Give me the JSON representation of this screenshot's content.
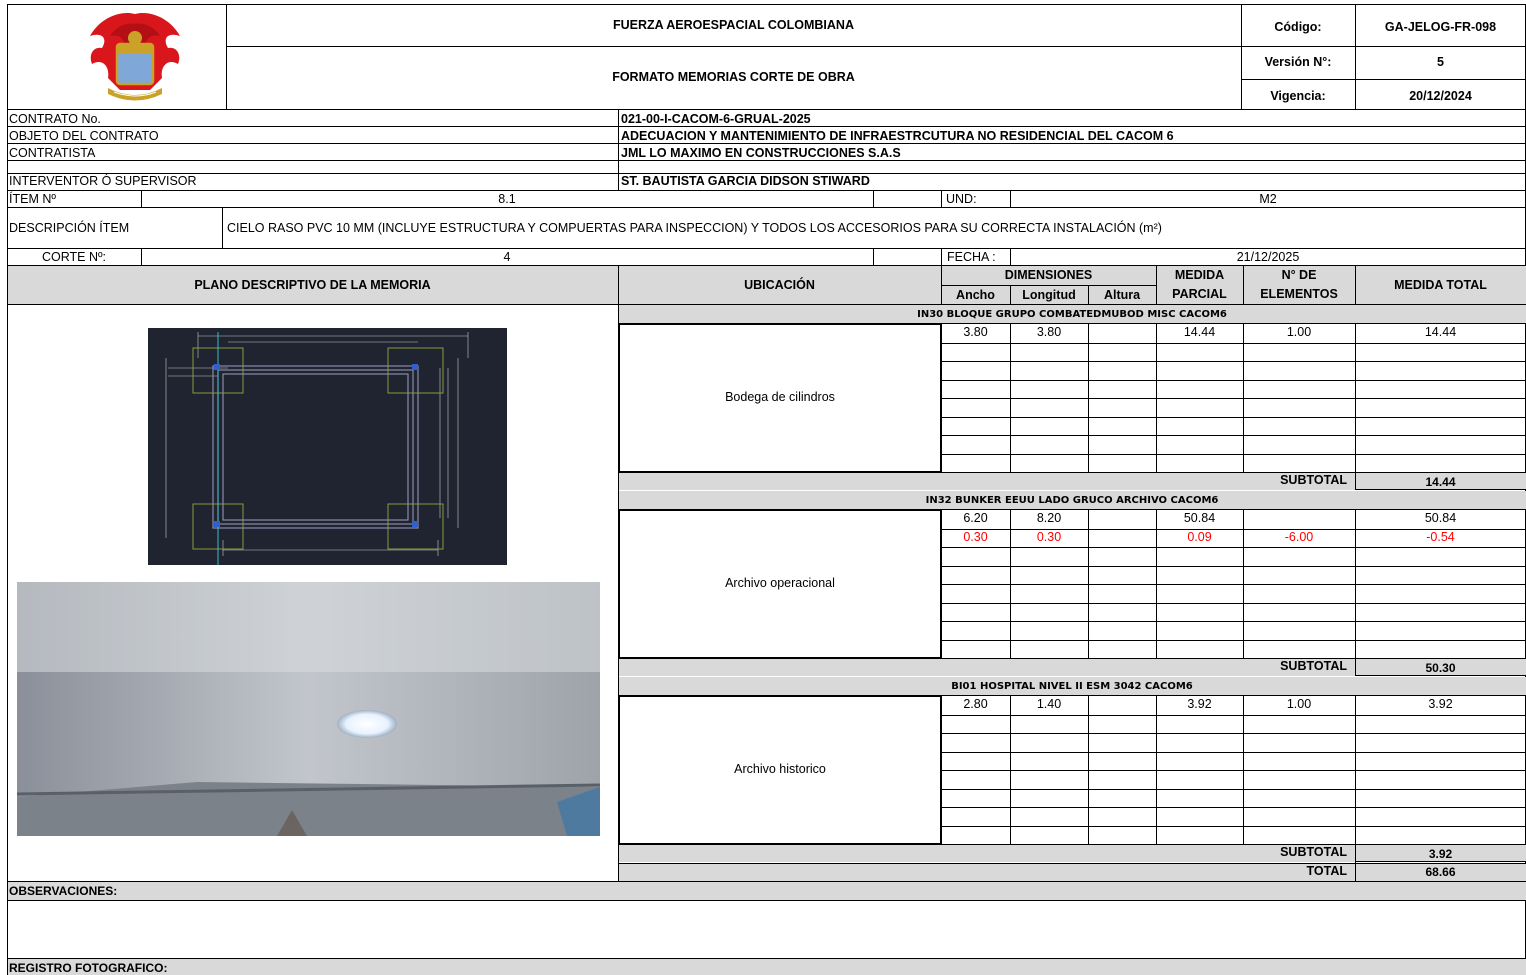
{
  "header": {
    "org": "FUERZA AEROESPACIAL COLOMBIANA",
    "form_title": "FORMATO MEMORIAS CORTE DE OBRA",
    "codigo_label": "Código:",
    "codigo_value": "GA-JELOG-FR-098",
    "version_label": "Versión N°:",
    "version_value": "5",
    "vigencia_label": "Vigencia:",
    "vigencia_value": "20/12/2024",
    "logo_icon": "eagle-crest-icon"
  },
  "contract": {
    "contrato_label": "CONTRATO No.",
    "contrato_value": "021-00-I-CACOM-6-GRUAL-2025",
    "objeto_label": "OBJETO  DEL CONTRATO",
    "objeto_value": "ADECUACION Y MANTENIMIENTO DE INFRAESTRCUTURA NO RESIDENCIAL DEL CACOM 6",
    "contratista_label": "CONTRATISTA",
    "contratista_value": "JML LO MAXIMO EN CONSTRUCCIONES S.A.S",
    "interventor_label": "INTERVENTOR Ó SUPERVISOR",
    "interventor_value": "ST. BAUTISTA GARCIA DIDSON STIWARD"
  },
  "item": {
    "item_label": "ÍTEM Nº",
    "item_value": "8.1",
    "und_label": "UND:",
    "und_value": "M2",
    "desc_label": "DESCRIPCIÓN ÍTEM",
    "desc_value": "CIELO RASO PVC 10 MM (INCLUYE ESTRUCTURA Y COMPUERTAS PARA INSPECCION) Y TODOS LOS ACCESORIOS PARA SU CORRECTA INSTALACIÓN (m²)",
    "corte_label": "CORTE Nº:",
    "corte_value": "4",
    "fecha_label": "FECHA :",
    "fecha_value": "21/12/2025"
  },
  "table_head": {
    "plano": "PLANO DESCRIPTIVO DE LA MEMORIA",
    "ubicacion": "UBICACIÓN",
    "dimensiones": "DIMENSIONES",
    "ancho": "Ancho",
    "longitud": "Longitud",
    "altura": "Altura",
    "medida1": "MEDIDA",
    "medida2": "PARCIAL",
    "n_de": "N° DE",
    "elementos": "ELEMENTOS",
    "medida_total": "MEDIDA TOTAL"
  },
  "sections": [
    {
      "title": "IN30 BLOQUE GRUPO COMBATEDMUBOD MISC CACOM6",
      "location": "Bodega de cilindros",
      "rows": [
        {
          "ancho": "3.80",
          "longitud": "3.80",
          "altura": "",
          "parcial": "14.44",
          "elementos": "1.00",
          "total": "14.44",
          "negative": false
        }
      ],
      "subtotal_label": "SUBTOTAL",
      "subtotal": "14.44"
    },
    {
      "title": "IN32 BUNKER EEUU LADO GRUCO ARCHIVO CACOM6",
      "location": "Archivo operacional",
      "rows": [
        {
          "ancho": "6.20",
          "longitud": "8.20",
          "altura": "",
          "parcial": "50.84",
          "elementos": "",
          "total": "50.84",
          "negative": false
        },
        {
          "ancho": "0.30",
          "longitud": "0.30",
          "altura": "",
          "parcial": "0.09",
          "elementos": "-6.00",
          "total": "-0.54",
          "negative": true
        }
      ],
      "subtotal_label": "SUBTOTAL",
      "subtotal": "50.30"
    },
    {
      "title": "BI01 HOSPITAL NIVEL II ESM 3042 CACOM6",
      "location": "Archivo historico",
      "rows": [
        {
          "ancho": "2.80",
          "longitud": "1.40",
          "altura": "",
          "parcial": "3.92",
          "elementos": "1.00",
          "total": "3.92",
          "negative": false
        }
      ],
      "subtotal_label": "SUBTOTAL",
      "subtotal": "3.92"
    }
  ],
  "total_label": "TOTAL",
  "total_value": "68.66",
  "observaciones_label": "OBSERVACIONES:",
  "registro_label": "REGISTRO FOTOGRAFICO:",
  "plan_image_icon": "floor-plan-drawing-icon",
  "photo_icon": "ceiling-photo-icon",
  "colors": {
    "header_gray": "#d9d9d9",
    "negative": "#ff0000",
    "cad_bg": "#1f2430"
  }
}
